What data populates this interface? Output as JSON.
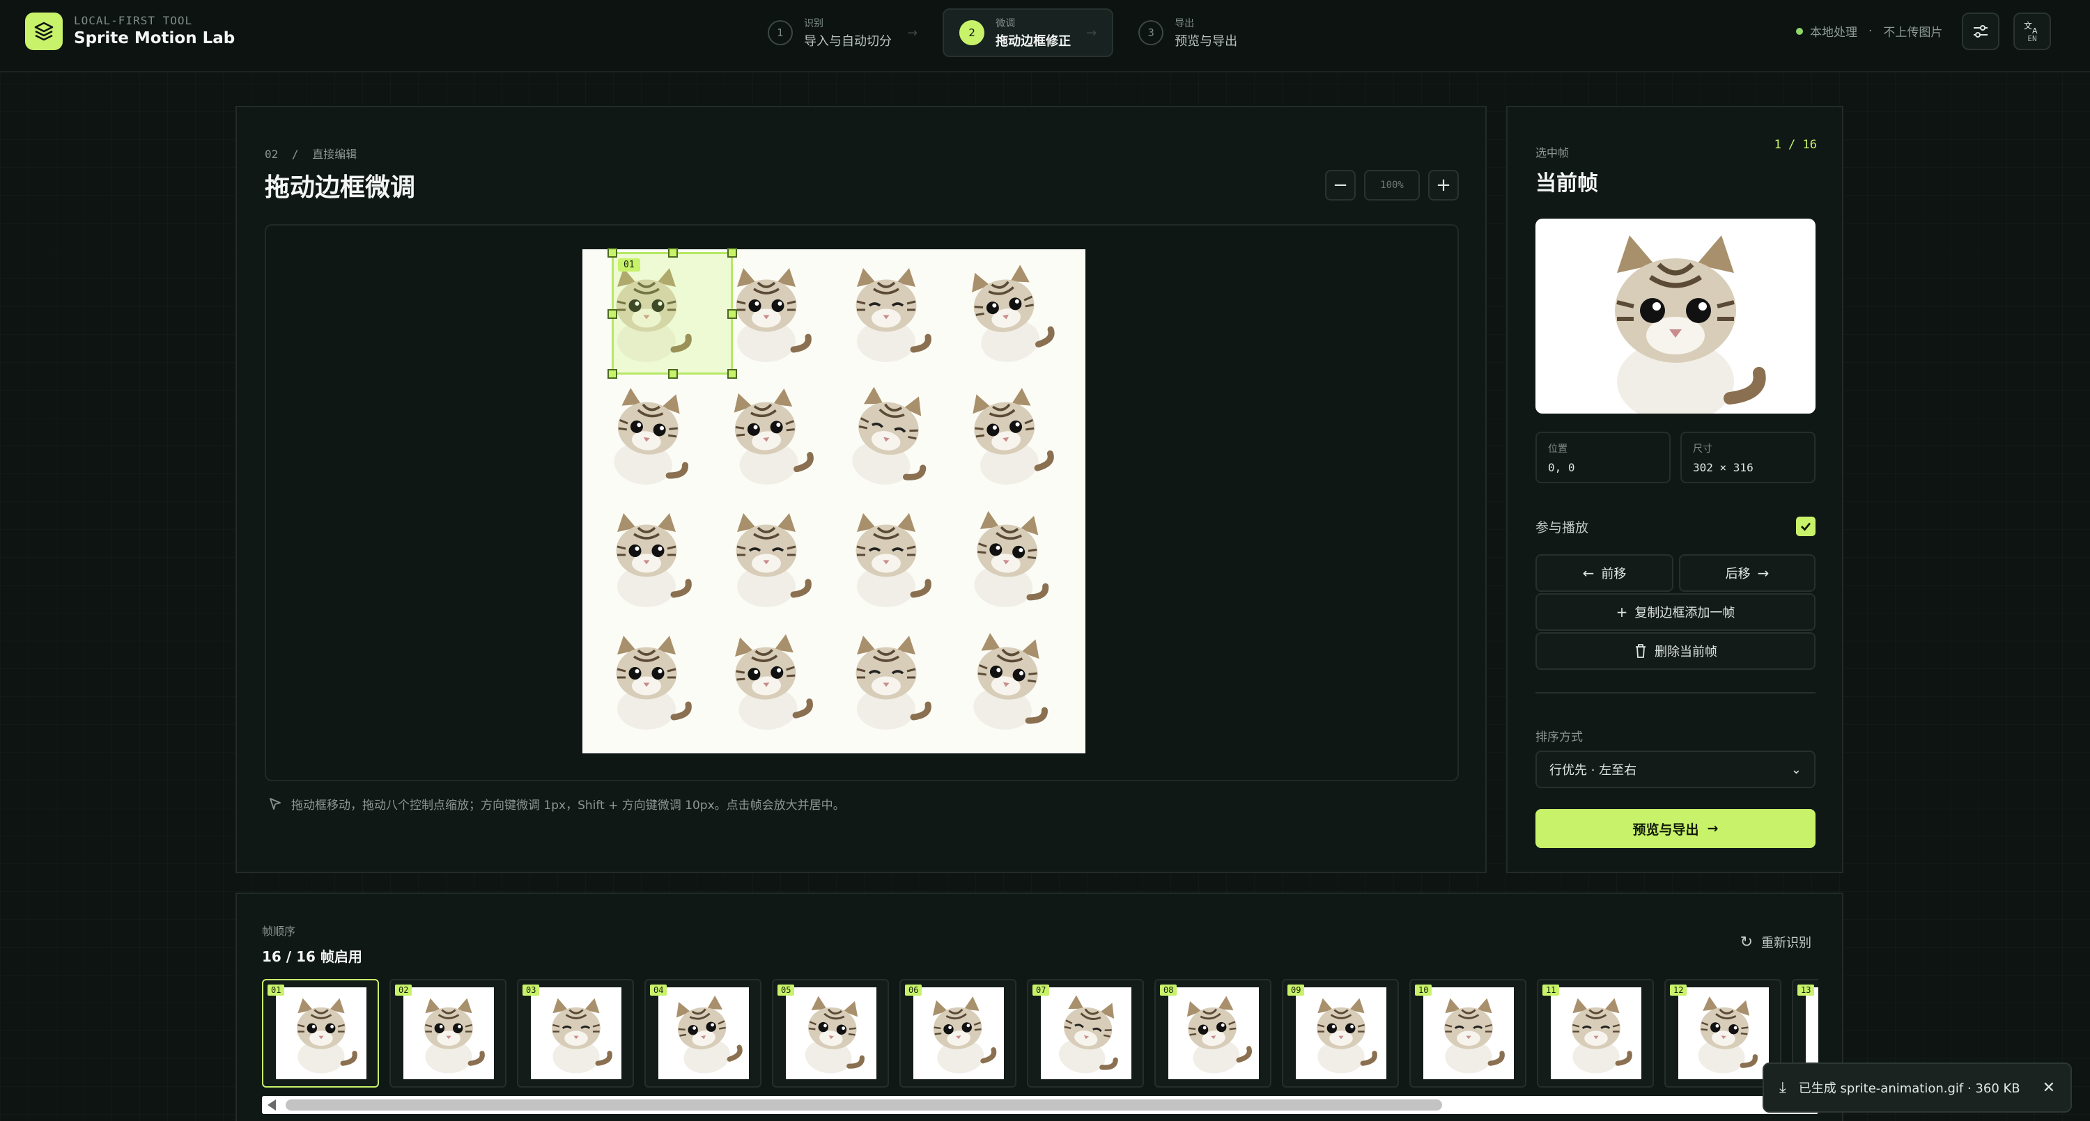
{
  "app": {
    "tagline": "LOCAL-FIRST TOOL",
    "name": "Sprite Motion Lab",
    "logo_icon": "layers-icon",
    "accent": "#c8f26a"
  },
  "steps": [
    {
      "num": "1",
      "small": "识别",
      "main": "导入与自动切分",
      "active": false
    },
    {
      "num": "2",
      "small": "微调",
      "main": "拖动边框修正",
      "active": true
    },
    {
      "num": "3",
      "small": "导出",
      "main": "预览与导出",
      "active": false
    }
  ],
  "header": {
    "local_processing": "本地处理",
    "no_upload": "不上传图片",
    "settings_icon": "sliders-icon",
    "lang_icon": "translate-icon",
    "lang_label": "EN"
  },
  "editor": {
    "breadcrumb_num": "02",
    "breadcrumb_label": "直接编辑",
    "title": "拖动边框微调",
    "zoom_minus": "−",
    "zoom_value": "100%",
    "zoom_plus": "+",
    "selected_frame_tag": "01",
    "hint": "拖动框移动，拖动八个控制点缩放；方向键微调 1px，Shift + 方向键微调 10px。点击帧会放大并居中。"
  },
  "inspector": {
    "small_label": "选中帧",
    "counter": "1 / 16",
    "title": "当前帧",
    "position_label": "位置",
    "position_value": "0, 0",
    "size_label": "尺寸",
    "size_value": "302 × 316",
    "play_label": "参与播放",
    "play_checked": true,
    "move_back": "前移",
    "move_forward": "后移",
    "duplicate": "复制边框添加一帧",
    "delete": "删除当前帧",
    "sort_label": "排序方式",
    "sort_value": "行优先 · 左至右",
    "cta": "预览与导出"
  },
  "filmstrip": {
    "small_label": "帧顺序",
    "count": "16 / 16 帧启用",
    "rerecognize": "重新识别",
    "frames": [
      "01",
      "02",
      "03",
      "04",
      "05",
      "06",
      "07",
      "08",
      "09",
      "10",
      "11",
      "12",
      "13"
    ],
    "active_index": 0
  },
  "toast": {
    "text": "已生成 sprite-animation.gif · 360 KB",
    "icon": "download-icon",
    "close_icon": "close-icon"
  }
}
